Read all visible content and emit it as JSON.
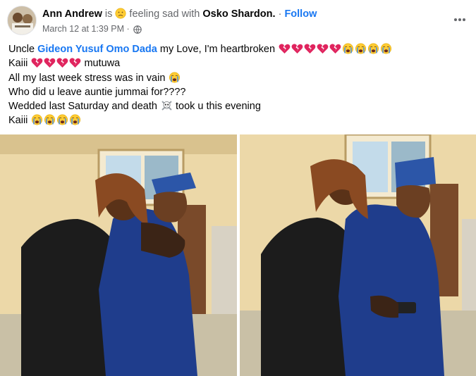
{
  "post": {
    "author": "Ann Andrew",
    "is_text": " is ",
    "feeling_text": " feeling sad with ",
    "tagged": "Osko Shardon",
    "tagged_suffix": ".",
    "dot": " · ",
    "follow_label": "Follow",
    "date": "March 12 at 1:39 PM",
    "date_sep": " · ",
    "privacy_icon": "globe-icon",
    "more_icon": "more-options-icon",
    "feeling_icon": "sad-face-emoji",
    "lines": [
      {
        "pre": "Uncle ",
        "mention": "Gideon Yusuf Omo Dada",
        "post": "  my Love, I'm heartbroken ",
        "icons": [
          "broken-heart",
          "broken-heart",
          "broken-heart",
          "broken-heart",
          "broken-heart",
          "crying-face",
          "crying-face",
          "crying-face",
          "crying-face"
        ]
      },
      {
        "pre": "Kaiii ",
        "icons_mid": [
          "broken-heart",
          "broken-heart",
          "broken-heart",
          "broken-heart"
        ],
        "post": " mutuwa"
      },
      {
        "pre": "All my last week stress was in vain ",
        "icons": [
          "crying-face"
        ]
      },
      {
        "pre": "Who did u leave auntie jummai for????"
      },
      {
        "pre": "Wedded last Saturday and death ",
        "icons_mid": [
          "skull-crossbones"
        ],
        "post": " took u this evening"
      },
      {
        "pre": "Kaiii ",
        "icons": [
          "crying-face",
          "crying-face",
          "crying-face",
          "crying-face"
        ]
      }
    ]
  },
  "photos": [
    {
      "label": "photo-left",
      "subject": "couple-embracing-photo"
    },
    {
      "label": "photo-right",
      "subject": "couple-embracing-photo"
    }
  ],
  "colors": {
    "link": "#1877f2",
    "muted": "#65676b",
    "wall": "#ecd8a8",
    "agbada": "#1f3d8c",
    "shirt": "#1c1c1c",
    "sky": "#c3dbea",
    "heart": "#e0245e",
    "emoji_face": "#ffcc33",
    "tears": "#4a90e2"
  }
}
